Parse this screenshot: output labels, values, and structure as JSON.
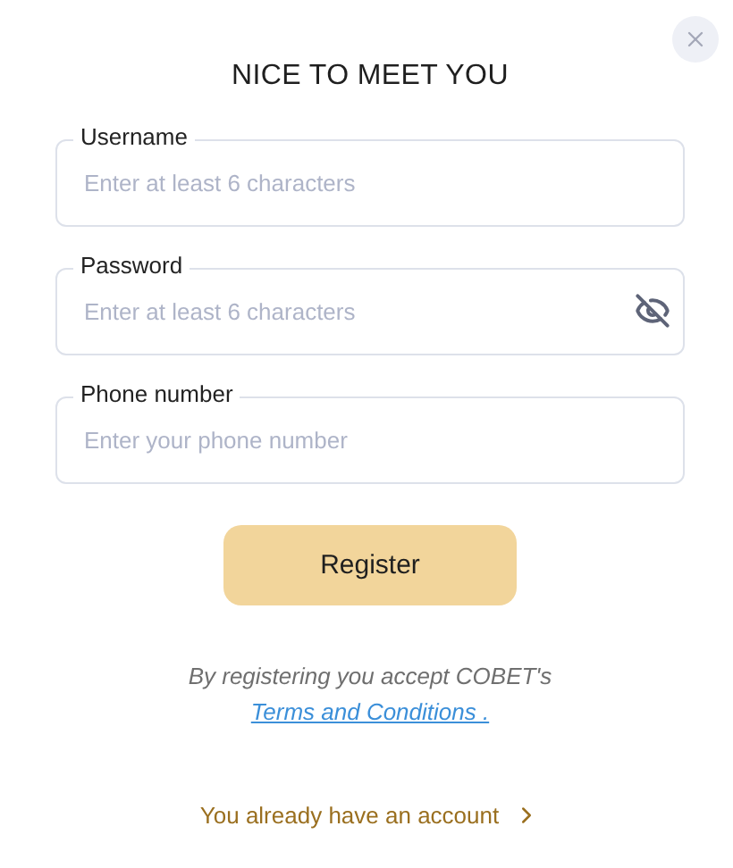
{
  "title": "NICE TO MEET YOU",
  "fields": [
    {
      "kind": "text",
      "label": "Username",
      "placeholder": "Enter at least 6 characters"
    },
    {
      "kind": "password",
      "label": "Password",
      "placeholder": "Enter at least 6 characters"
    },
    {
      "kind": "text",
      "label": "Phone number",
      "placeholder": "Enter your phone number"
    }
  ],
  "submit": "Register",
  "terms": {
    "text": "By registering you accept COBET's",
    "link": "Terms and Conditions ."
  },
  "login_link": "You already have an account"
}
